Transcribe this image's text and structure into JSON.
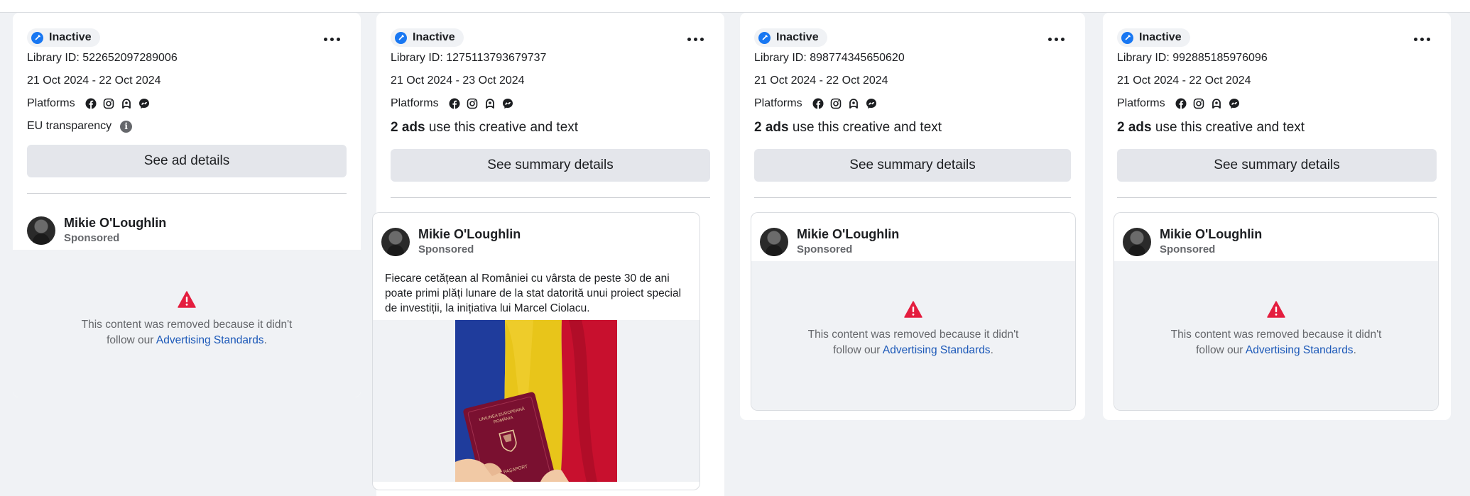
{
  "cards": [
    {
      "status": "Inactive",
      "library_id": "Library ID: 522652097289006",
      "dates": "21 Oct 2024 - 22 Oct 2024",
      "platforms_label": "Platforms",
      "eu_transparency": "EU transparency",
      "button": "See ad details",
      "advertiser": "Mikie O'Loughlin",
      "sponsored": "Sponsored",
      "removed_msg": "This content was removed because it didn't follow our",
      "removed_link": "Advertising Standards",
      "removed_end": "."
    },
    {
      "status": "Inactive",
      "library_id": "Library ID: 1275113793679737",
      "dates": "21 Oct 2024 - 23 Oct 2024",
      "platforms_label": "Platforms",
      "ads_count": "2 ads",
      "ads_text": "use this creative and text",
      "button": "See summary details",
      "advertiser": "Mikie O'Loughlin",
      "sponsored": "Sponsored",
      "caption": "Fiecare cetățean al României cu vârsta de peste 30 de ani poate primi plăți lunare de la stat datorită unui proiect special de investiții, la inițiativa lui Marcel Ciolacu.",
      "passport_line1": "UNIUNEA EUROPEANĂ",
      "passport_line2": "ROMÂNIA",
      "passport_word": "PAȘAPORT"
    },
    {
      "status": "Inactive",
      "library_id": "Library ID: 898774345650620",
      "dates": "21 Oct 2024 - 22 Oct 2024",
      "platforms_label": "Platforms",
      "ads_count": "2 ads",
      "ads_text": "use this creative and text",
      "button": "See summary details",
      "advertiser": "Mikie O'Loughlin",
      "sponsored": "Sponsored",
      "removed_msg": "This content was removed because it didn't follow our",
      "removed_link": "Advertising Standards",
      "removed_end": "."
    },
    {
      "status": "Inactive",
      "library_id": "Library ID: 992885185976096",
      "dates": "21 Oct 2024 - 22 Oct 2024",
      "platforms_label": "Platforms",
      "ads_count": "2 ads",
      "ads_text": "use this creative and text",
      "button": "See summary details",
      "advertiser": "Mikie O'Loughlin",
      "sponsored": "Sponsored",
      "removed_msg": "This content was removed because it didn't follow our",
      "removed_link": "Advertising Standards",
      "removed_end": "."
    }
  ],
  "icons": {
    "status": "checkmark-badge-icon",
    "platforms": [
      "facebook-icon",
      "instagram-icon",
      "audience-network-icon",
      "messenger-icon"
    ],
    "more": "more-options-icon",
    "info": "info-icon",
    "warning": "warning-icon"
  },
  "colors": {
    "accent": "#1877f2",
    "link": "#1b58b8",
    "warning": "#e41e3f",
    "flag_blue": "#1f3c9c",
    "flag_yellow": "#f3d21a",
    "flag_red": "#c8102e",
    "passport": "#7a1030"
  }
}
